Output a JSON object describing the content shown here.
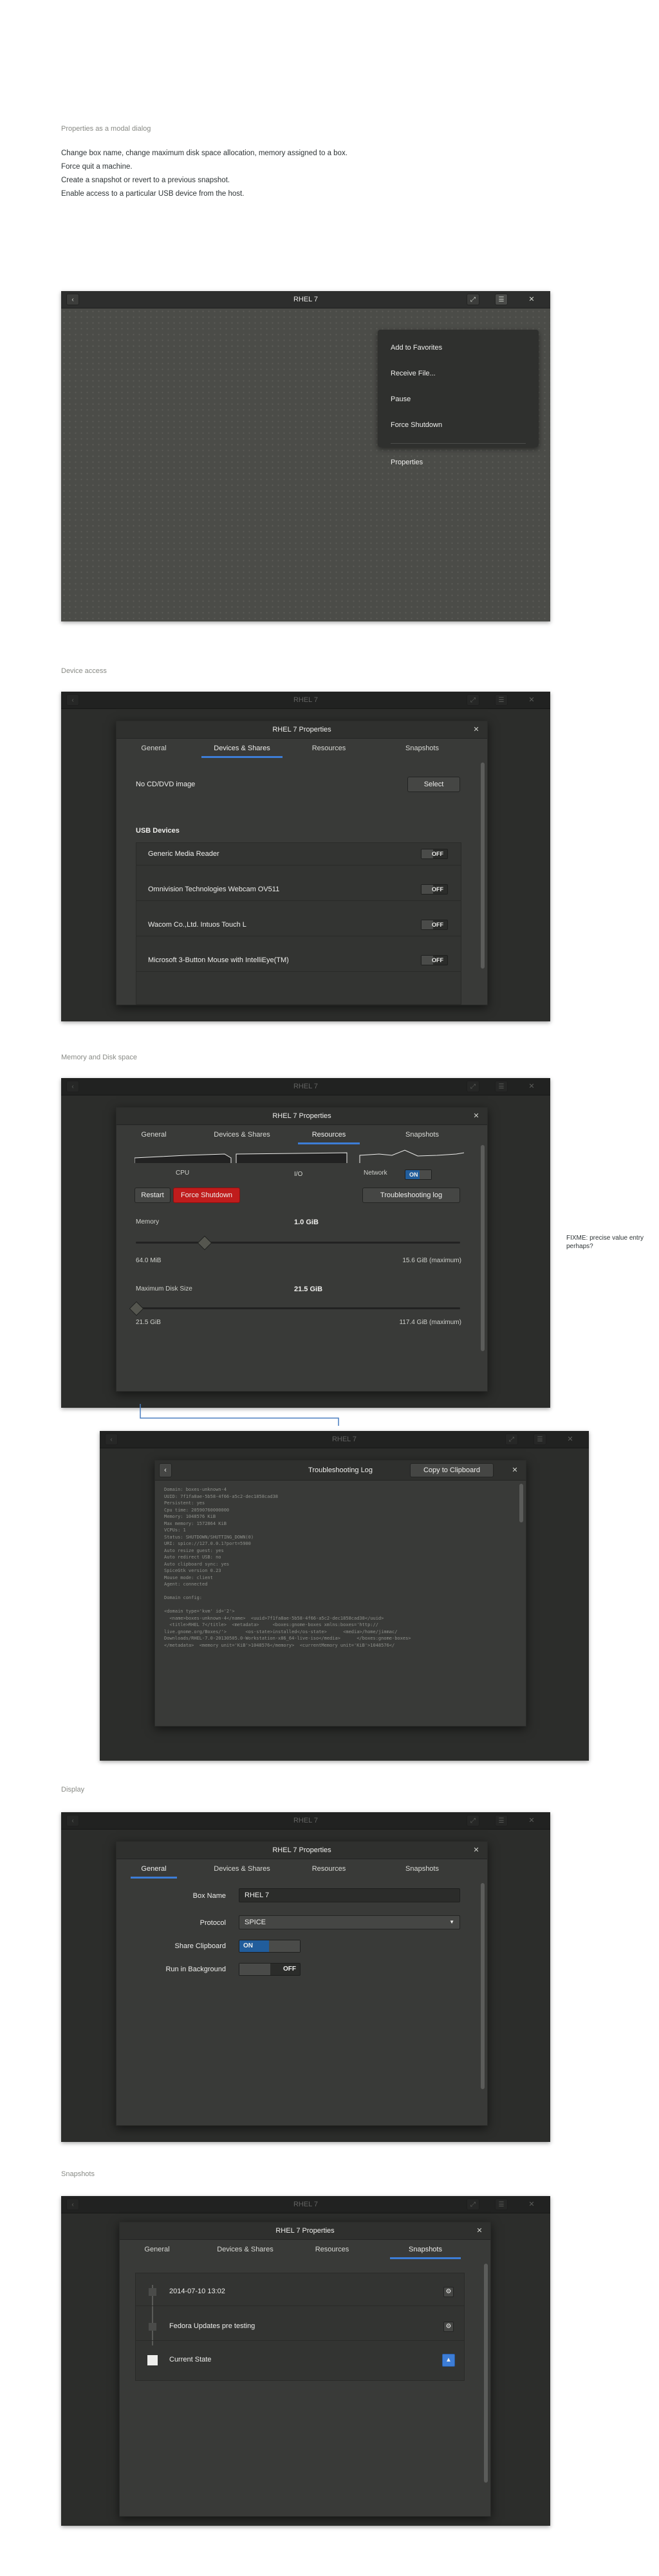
{
  "intro": {
    "heading": "Properties as a modal dialog",
    "lines": [
      "Change box name, change maximum disk space allocation, memory assigned to a box.",
      "Force quit a machine.",
      "Create a snapshot or revert to a previous snapshot.",
      "Enable access to a particular USB device from the host."
    ]
  },
  "window_title": "RHEL 7",
  "menu": {
    "items": [
      "Add to Favorites",
      "Receive File...",
      "Pause",
      "Force Shutdown"
    ],
    "properties": "Properties"
  },
  "dialog_title": "RHEL 7 Properties",
  "tabs": [
    "General",
    "Devices & Shares",
    "Resources",
    "Snapshots"
  ],
  "sections": {
    "device_access": "Device access",
    "memory_disk": "Memory and Disk space",
    "display": "Display",
    "snapshots": "Snapshots"
  },
  "devices": {
    "cd_label": "No CD/DVD image",
    "select_button": "Select",
    "usb_heading": "USB Devices",
    "usb": [
      {
        "name": "Generic Media Reader",
        "state": "OFF"
      },
      {
        "name": "Omnivision Technologies Webcam OV511",
        "state": "OFF"
      },
      {
        "name": "Wacom Co.,Ltd. Intuos Touch L",
        "state": "OFF"
      },
      {
        "name": "Microsoft 3-Button Mouse with IntelliEye(TM)",
        "state": "OFF"
      }
    ]
  },
  "resources": {
    "graphs": {
      "cpu": "CPU",
      "io": "I/O",
      "network": "Network",
      "network_state": "ON"
    },
    "restart": "Restart",
    "force_shutdown": "Force Shutdown",
    "troubleshooting": "Troubleshooting log",
    "memory_label": "Memory",
    "memory_value": "1.0 GiB",
    "memory_min": "64.0 MiB",
    "memory_max": "15.6 GiB (maximum)",
    "memory_fraction": 0.065,
    "disk_label": "Maximum Disk Size",
    "disk_value": "21.5 GiB",
    "disk_min": "21.5 GiB",
    "disk_max": "117.4 GiB (maximum)",
    "disk_fraction": 0.0,
    "fixme": "FIXME: precise value entry perhaps?"
  },
  "log": {
    "title": "Troubleshooting Log",
    "copy": "Copy to Clipboard",
    "text": "Domain: boxes-unknown-4\nUUID: 7f1fa8ae-5b58-4f66-a5c2-dec1858cad38\nPersistent: yes\nCpu time: 20590760000000\nMemory: 1048576 KiB\nMax memory: 1572864 KiB\nVCPUs: 1\nStatus: SHUTDOWN/SHUTTING_DOWN(0)\nURI: spice://127.0.0.1?port=5900\nAuto resize guest: yes\nAuto redirect USB: no\nAuto clipboard sync: yes\nSpiceGtk version 0.23\nMouse mode: client\nAgent: connected\n\nDomain config:\n\n<domain type='kvm' id='2'>\n  <name>boxes-unknown-4</name>  <uuid>7f1fa8ae-5b58-4f66-a5c2-dec1858cad38</uuid>\n  <title>RHEL 7</title>  <metadata>     <boxes:gnome-boxes xmlns:boxes='http://\nlive.gnome.org/Boxes/'>       <os-state>installed</os-state>      <media>/home/jimmac/\nDownloads/RHEL-7.0-20130505.0-Workstation-x86_64-live-iso</media>      </boxes:gnome-boxes>\n</metadata>  <memory unit='KiB'>1048576</memory>  <currentMemory unit='KiB'>1048576</"
  },
  "display": {
    "box_name_label": "Box Name",
    "box_name_value": "RHEL 7",
    "protocol_label": "Protocol",
    "protocol_value": "SPICE",
    "clipboard_label": "Share Clipboard",
    "clipboard_state": "ON",
    "background_label": "Run in Background",
    "background_state": "OFF"
  },
  "snapshots": {
    "items": [
      "2014-07-10 13:02",
      "Fedora Updates pre testing"
    ],
    "current": "Current State"
  }
}
